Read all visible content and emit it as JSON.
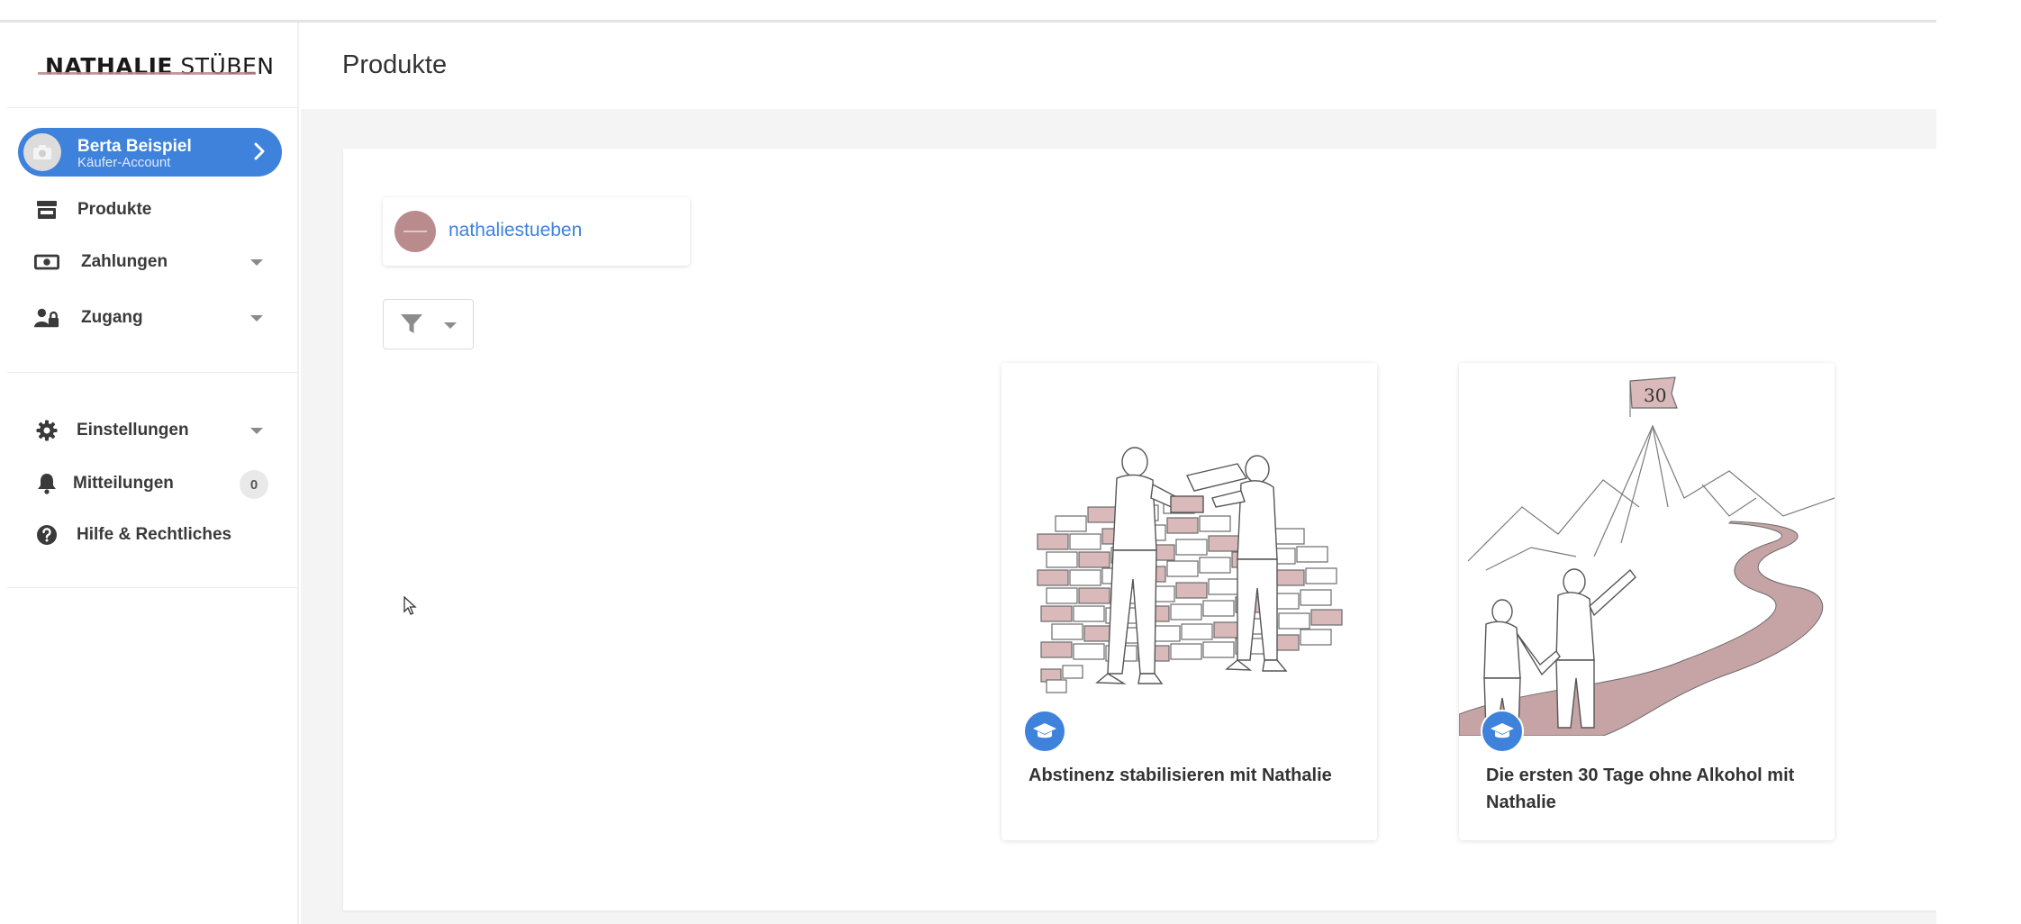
{
  "brand": {
    "logo_bold": "NATHALIE",
    "logo_light": "STÜBEN",
    "accent": "#3f82db",
    "rose": "#b98a8e"
  },
  "user": {
    "name": "Berta Beispiel",
    "role": "Käufer-Account"
  },
  "nav": {
    "produkte": "Produkte",
    "zahlungen": "Zahlungen",
    "zugang": "Zugang",
    "einstellungen": "Einstellungen",
    "mitteilungen": "Mitteilungen",
    "mitteilungen_count": "0",
    "hilfe": "Hilfe & Rechtliches"
  },
  "header": {
    "title": "Produkte"
  },
  "store": {
    "name": "nathaliestueben"
  },
  "products": [
    {
      "title": "Abstinenz stabilisieren mit Nathalie",
      "icon": "graduation-cap-icon"
    },
    {
      "title": "Die ersten 30 Tage ohne Alkohol mit Nathalie",
      "icon": "graduation-cap-icon",
      "flag_text": "30"
    }
  ]
}
